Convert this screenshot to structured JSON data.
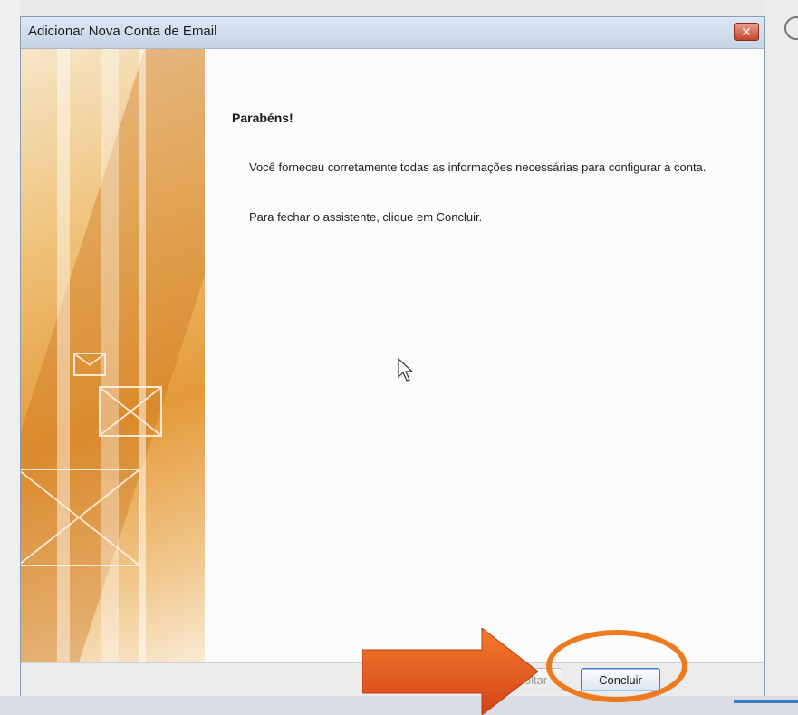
{
  "window": {
    "title": "Adicionar Nova Conta de Email",
    "close_icon": "close-icon"
  },
  "content": {
    "heading": "Parabéns!",
    "line1": "Você forneceu corretamente todas as informações necessárias para configurar a conta.",
    "line2": "Para fechar o assistente, clique em Concluir."
  },
  "footer": {
    "back_label": "< Voltar",
    "finish_label": "Concluir"
  },
  "colors": {
    "annotation": "#ee7a1f",
    "titlebar": "#c5d4e6",
    "art_orange": "#e49a3a"
  }
}
